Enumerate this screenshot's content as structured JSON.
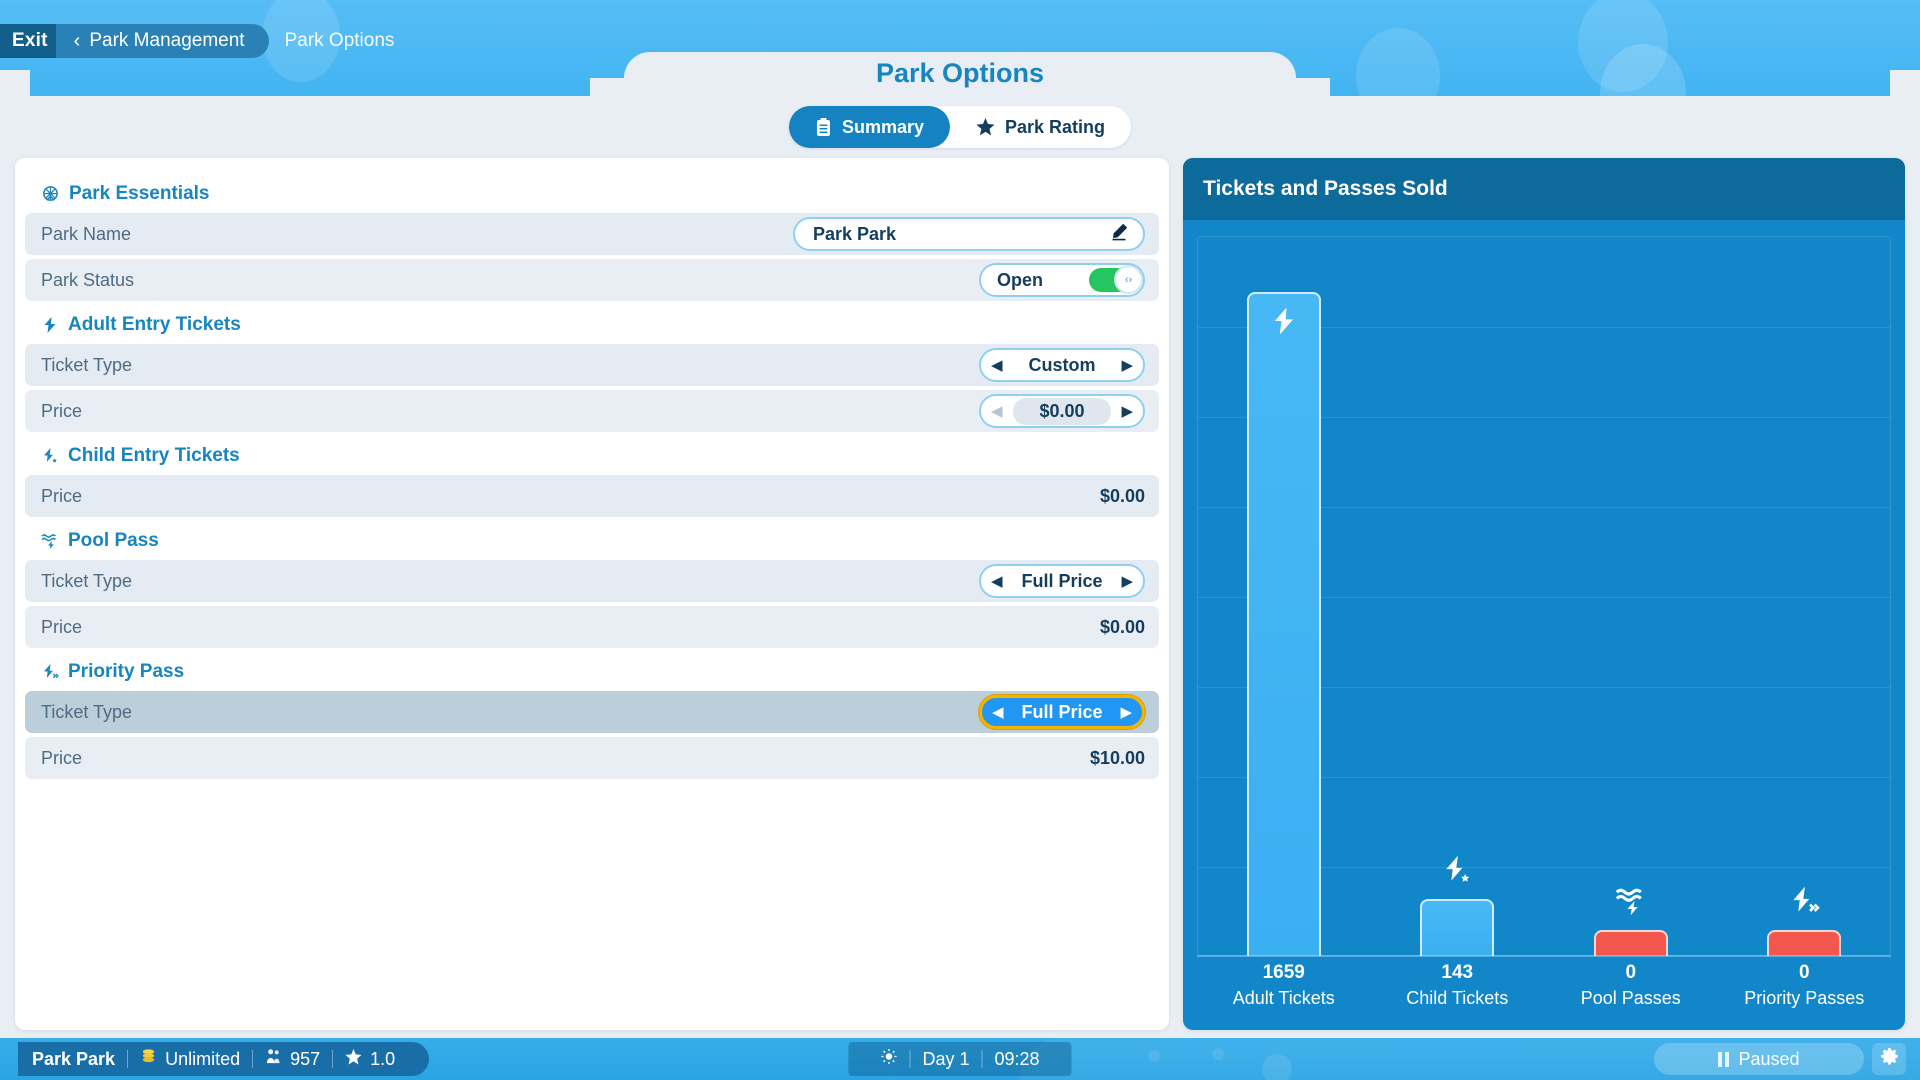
{
  "breadcrumb": {
    "exit": "Exit",
    "parent": "Park Management",
    "current": "Park Options"
  },
  "header": {
    "title": "Park Options"
  },
  "tabs": [
    {
      "label": "Summary",
      "icon": "clipboard-icon",
      "active": true
    },
    {
      "label": "Park Rating",
      "icon": "star-icon",
      "active": false
    }
  ],
  "sections": [
    {
      "title": "Park Essentials",
      "icon": "ferris-wheel-icon",
      "rows": [
        {
          "label": "Park Name",
          "control": "text-input",
          "value": "Park Park"
        },
        {
          "label": "Park Status",
          "control": "toggle",
          "value": "Open",
          "on": true
        }
      ]
    },
    {
      "title": "Adult Entry Tickets",
      "icon": "ticket-icon",
      "rows": [
        {
          "label": "Ticket Type",
          "control": "spinner",
          "value": "Custom"
        },
        {
          "label": "Price",
          "control": "spinner-pill",
          "value": "$0.00",
          "left_disabled": true
        }
      ]
    },
    {
      "title": "Child Entry Tickets",
      "icon": "child-ticket-icon",
      "rows": [
        {
          "label": "Price",
          "control": "static",
          "value": "$0.00"
        }
      ]
    },
    {
      "title": "Pool Pass",
      "icon": "pool-pass-icon",
      "rows": [
        {
          "label": "Ticket Type",
          "control": "spinner",
          "value": "Full Price"
        },
        {
          "label": "Price",
          "control": "static",
          "value": "$0.00"
        }
      ]
    },
    {
      "title": "Priority Pass",
      "icon": "priority-pass-icon",
      "rows": [
        {
          "label": "Ticket Type",
          "control": "spinner",
          "value": "Full Price",
          "selected": true
        },
        {
          "label": "Price",
          "control": "static",
          "value": "$10.00"
        }
      ]
    }
  ],
  "chart_panel": {
    "title": "Tickets and Passes Sold"
  },
  "chart_data": {
    "type": "bar",
    "title": "Tickets and Passes Sold",
    "categories": [
      "Adult Tickets",
      "Child Tickets",
      "Pool Passes",
      "Priority Passes"
    ],
    "values": [
      1659,
      143,
      0,
      0
    ],
    "colors": [
      "#48b8f5",
      "#48b8f5",
      "#f1574c",
      "#f1574c"
    ],
    "icons": [
      "ticket-icon",
      "child-ticket-icon",
      "pool-pass-icon",
      "priority-pass-icon"
    ],
    "xlabel": "",
    "ylabel": "",
    "ylim": [
      0,
      1800
    ],
    "grid": true,
    "gridlines": 8,
    "legend": "none"
  },
  "statusbar": {
    "park_name": "Park Park",
    "money": "Unlimited",
    "money_icon": "coins-icon",
    "guests": "957",
    "guests_icon": "guests-icon",
    "rating": "1.0",
    "rating_icon": "star-icon",
    "weather_icon": "sun-icon",
    "day": "Day 1",
    "time": "09:28",
    "speed": "Paused",
    "speed_icon": "pause-icon",
    "settings_icon": "gear-icon"
  },
  "colors": {
    "banner": "#42b4f2",
    "accent": "#1785c0",
    "chart_panel": "#1187c9",
    "chart_header": "#0d6b9b",
    "bar_blue": "#48b8f5",
    "bar_red": "#f1574c",
    "highlight": "#f5b301",
    "toggle_on": "#25c660"
  }
}
